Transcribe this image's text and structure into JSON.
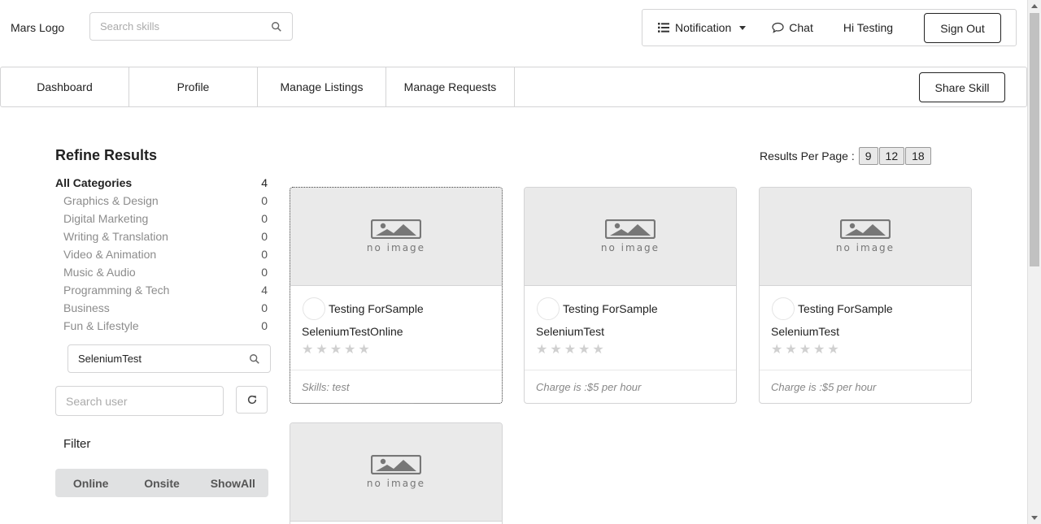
{
  "header": {
    "logo": "Mars Logo",
    "search_placeholder": "Search skills",
    "notification_label": "Notification",
    "chat_label": "Chat",
    "greeting": "Hi Testing",
    "signout_label": "Sign Out"
  },
  "nav": {
    "items": [
      {
        "label": "Dashboard"
      },
      {
        "label": "Profile"
      },
      {
        "label": "Manage Listings"
      },
      {
        "label": "Manage Requests"
      }
    ],
    "share_label": "Share Skill"
  },
  "sidebar": {
    "title": "Refine Results",
    "all_categories": {
      "label": "All Categories",
      "count": "4"
    },
    "categories": [
      {
        "label": "Graphics & Design",
        "count": "0"
      },
      {
        "label": "Digital Marketing",
        "count": "0"
      },
      {
        "label": "Writing & Translation",
        "count": "0"
      },
      {
        "label": "Video & Animation",
        "count": "0"
      },
      {
        "label": "Music & Audio",
        "count": "0"
      },
      {
        "label": "Programming & Tech",
        "count": "4"
      },
      {
        "label": "Business",
        "count": "0"
      },
      {
        "label": "Fun & Lifestyle",
        "count": "0"
      }
    ],
    "skill_search_value": "SeleniumTest",
    "user_search_placeholder": "Search user",
    "filter_label": "Filter",
    "filters": [
      {
        "label": "Online"
      },
      {
        "label": "Onsite"
      },
      {
        "label": "ShowAll"
      }
    ]
  },
  "results": {
    "per_page_label": "Results Per Page :",
    "per_page_options": [
      "9",
      "12",
      "18"
    ],
    "no_image_text": "no image",
    "cards": [
      {
        "seller": "Testing ForSample",
        "title": "SeleniumTestOnline",
        "footer": "Skills: test"
      },
      {
        "seller": "Testing ForSample",
        "title": "SeleniumTest",
        "footer": "Charge is :$5 per hour"
      },
      {
        "seller": "Testing ForSample",
        "title": "SeleniumTest",
        "footer": "Charge is :$5 per hour"
      },
      {
        "seller": "",
        "title": "",
        "footer": ""
      }
    ]
  },
  "icons": {
    "search": "search-icon",
    "list": "list-icon",
    "chat": "chat-bubble-icon",
    "refresh": "refresh-icon",
    "image": "image-placeholder-icon",
    "star": "star-icon"
  }
}
